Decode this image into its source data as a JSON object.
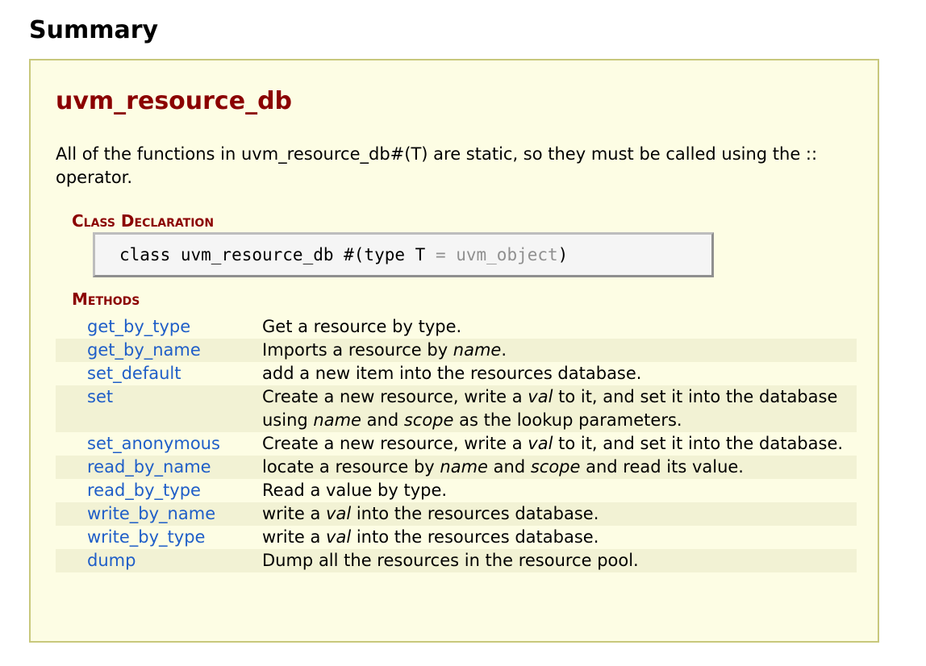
{
  "page": {
    "heading": "Summary"
  },
  "class": {
    "title": "uvm_resource_db",
    "description": "All of the functions in uvm_resource_db#(T) are static, so they must be called using the :: operator."
  },
  "declaration": {
    "section_title": "Class Declaration",
    "code_main": "class uvm_resource_db #(type T ",
    "code_default": "= uvm_object",
    "code_close": ")"
  },
  "methods": {
    "section_title": "Methods",
    "items": [
      {
        "name": "get_by_type",
        "desc": [
          {
            "t": "Get a resource by type."
          }
        ]
      },
      {
        "name": "get_by_name",
        "desc": [
          {
            "t": "Imports a resource by "
          },
          {
            "t": "name",
            "i": true
          },
          {
            "t": "."
          }
        ]
      },
      {
        "name": "set_default",
        "desc": [
          {
            "t": "add a new item into the resources database."
          }
        ]
      },
      {
        "name": "set",
        "desc": [
          {
            "t": "Create a new resource, write a "
          },
          {
            "t": "val",
            "i": true
          },
          {
            "t": " to it, and set it into the database using "
          },
          {
            "t": "name",
            "i": true
          },
          {
            "t": " and "
          },
          {
            "t": "scope",
            "i": true
          },
          {
            "t": " as the lookup parameters."
          }
        ]
      },
      {
        "name": "set_anonymous",
        "desc": [
          {
            "t": "Create a new resource, write a "
          },
          {
            "t": "val",
            "i": true
          },
          {
            "t": " to it, and set it into the database."
          }
        ]
      },
      {
        "name": "read_by_name",
        "desc": [
          {
            "t": "locate a resource by "
          },
          {
            "t": "name",
            "i": true
          },
          {
            "t": " and "
          },
          {
            "t": "scope",
            "i": true
          },
          {
            "t": " and read its value."
          }
        ]
      },
      {
        "name": "read_by_type",
        "desc": [
          {
            "t": "Read a value by type."
          }
        ]
      },
      {
        "name": "write_by_name",
        "desc": [
          {
            "t": "write a "
          },
          {
            "t": "val",
            "i": true
          },
          {
            "t": " into the resources database."
          }
        ]
      },
      {
        "name": "write_by_type",
        "desc": [
          {
            "t": "write a "
          },
          {
            "t": "val",
            "i": true
          },
          {
            "t": " into the resources database."
          }
        ]
      },
      {
        "name": "dump",
        "desc": [
          {
            "t": "Dump all the resources in the resource pool."
          }
        ]
      }
    ]
  },
  "colors": {
    "title": "#8b0000",
    "link": "#1f5ec8",
    "box_bg": "#fdfde4",
    "box_border": "#c8c87c",
    "row_alt": "#f2f2d4"
  }
}
